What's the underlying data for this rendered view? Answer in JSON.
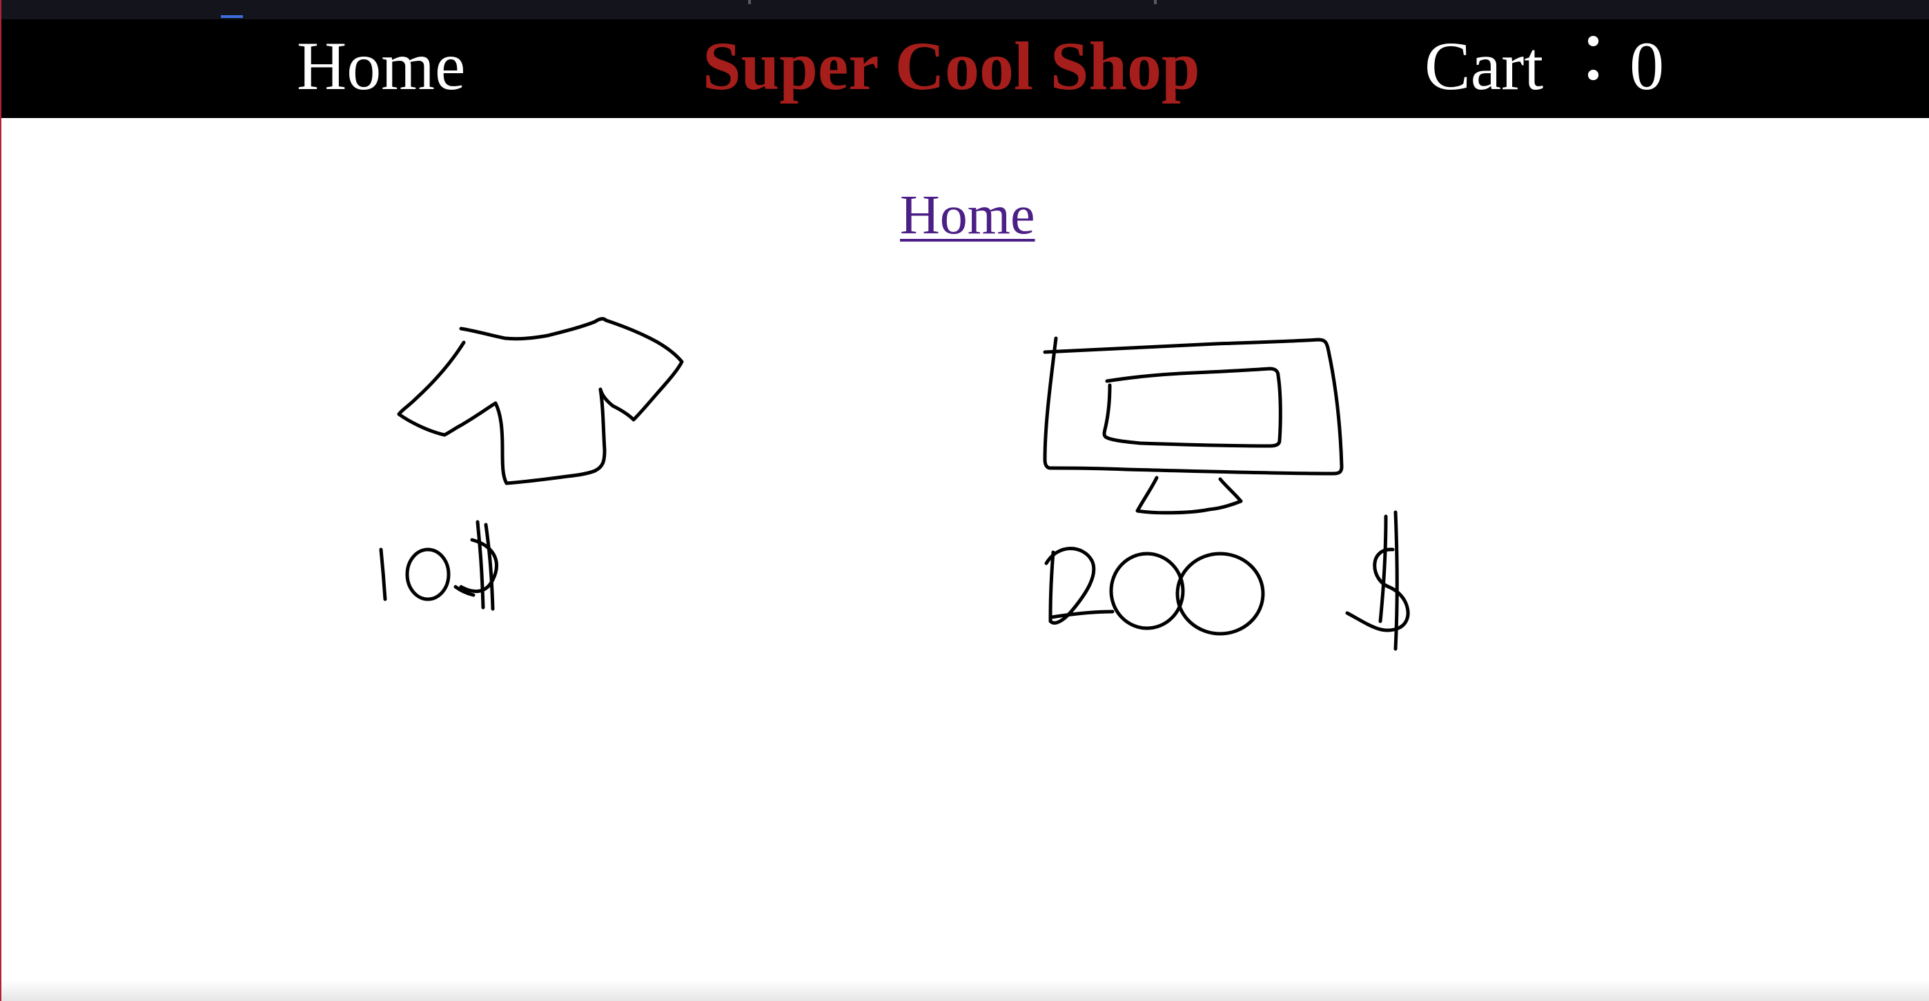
{
  "navbar": {
    "home_label": "Home",
    "title": "Super Cool Shop",
    "cart_label": "Cart︓ 0"
  },
  "main": {
    "home_link": "Home"
  },
  "products": [
    {
      "name": "t-shirt",
      "icon": "t-shirt-sketch",
      "price": "10$"
    },
    {
      "name": "monitor",
      "icon": "monitor-sketch",
      "price": "200$"
    }
  ],
  "colors": {
    "navbar_bg": "#000000",
    "title": "#a61e1b",
    "link": "#4b1f86",
    "sketch": "#000000"
  }
}
